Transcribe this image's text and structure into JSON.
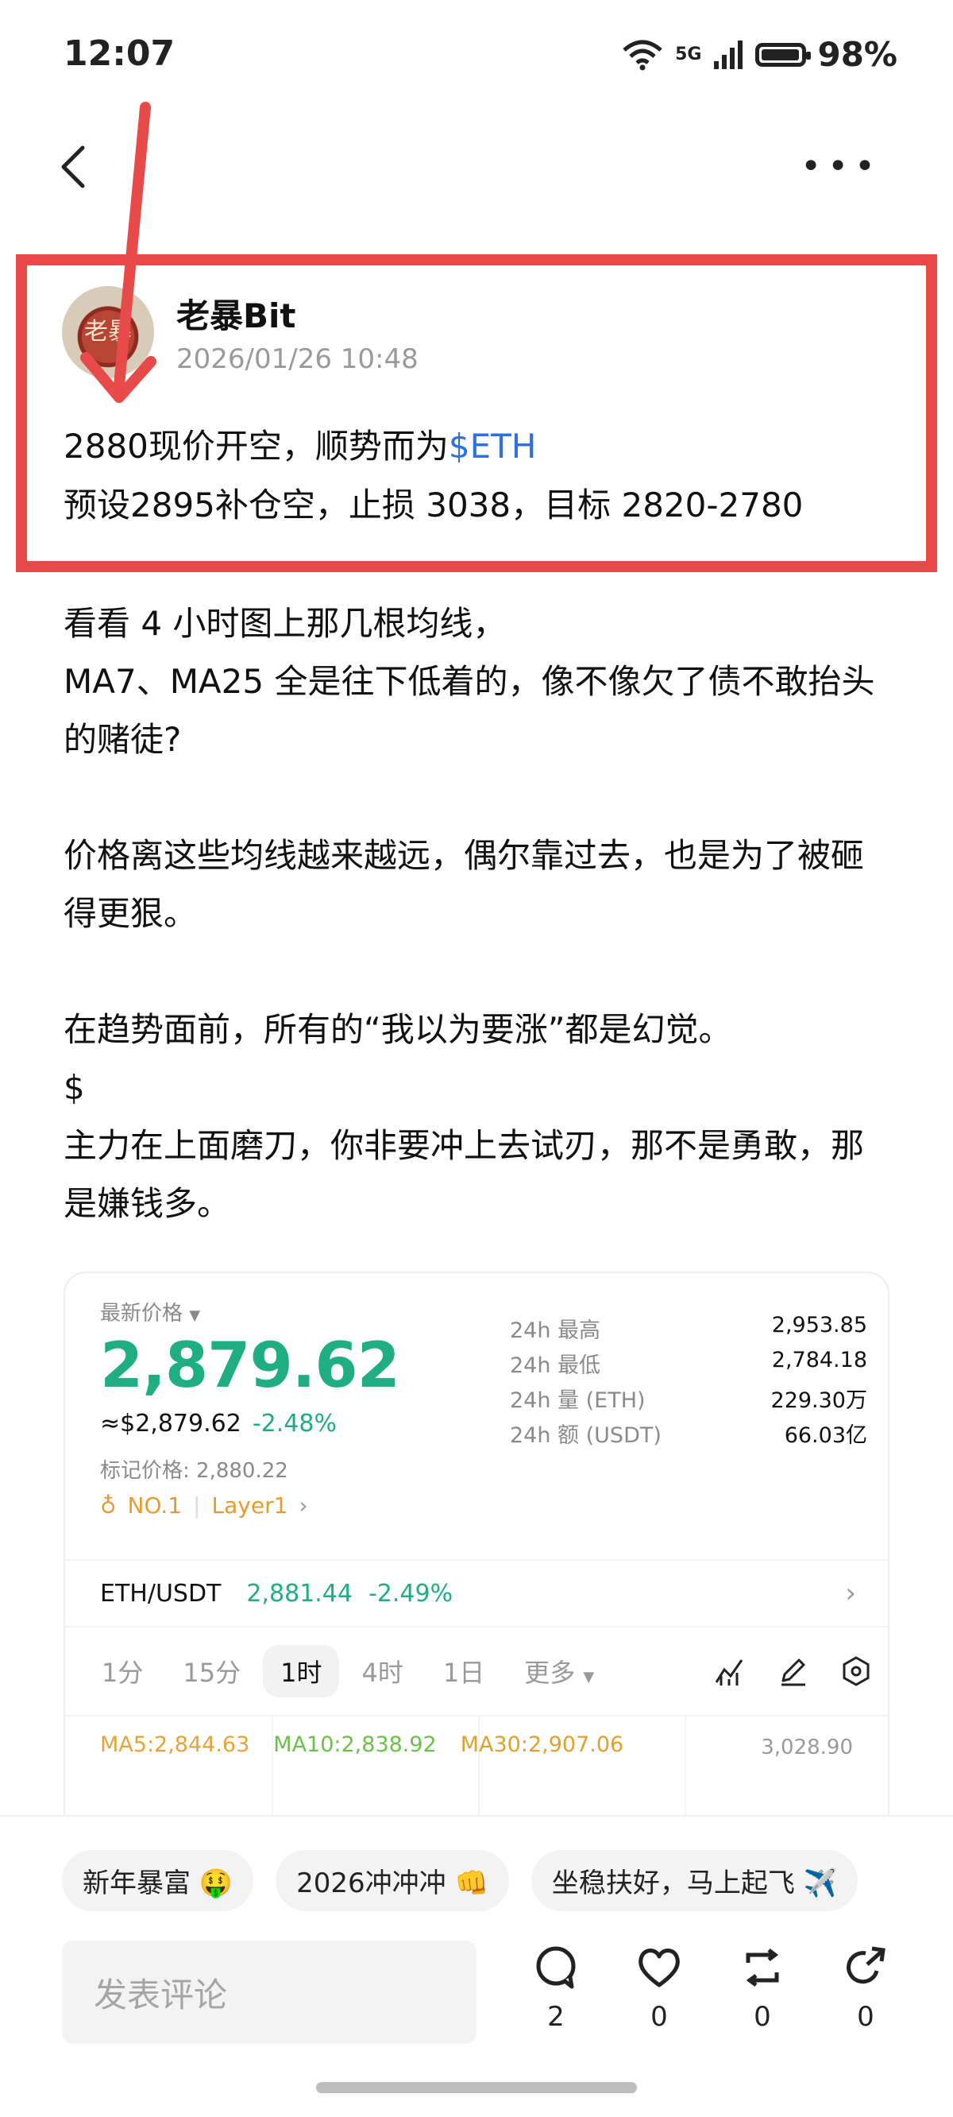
{
  "status_bar": {
    "time": "12:07",
    "network": "5G",
    "battery": "98%",
    "battery_level": 0.98
  },
  "post": {
    "author": "老暴Bit",
    "avatar_text": "老暴",
    "date": "2026/01/26 10:48",
    "line1_text": "2880现价开空，顺势而为",
    "line1_link": "$ETH",
    "line2": "预设2895补仓空，止损 3038，目标 2820-2780",
    "body": [
      "看看 4 小时图上那几根均线，",
      "MA7、MA25 全是往下低着的，像不像欠了债不敢抬头的赌徒?",
      "",
      "价格离这些均线越来越远，偶尔靠过去，也是为了被砸得更狠。",
      "",
      "在趋势面前，所有的“我以为要涨”都是幻觉。",
      "$",
      "主力在上面磨刀，你非要冲上去试刃，那不是勇敢，那是嫌钱多。"
    ]
  },
  "market": {
    "latest_price_label": "最新价格",
    "price": "2,879.62",
    "approx_price": "≈$2,879.62",
    "change": "-2.48%",
    "mark_price": "标记价格: 2,880.22",
    "rank": "NO.1",
    "category": "Layer1",
    "stats": [
      {
        "label": "24h  最高",
        "value": "2,953.85"
      },
      {
        "label": "24h  最低",
        "value": "2,784.18"
      },
      {
        "label": "24h  量 (ETH)",
        "value": "229.30万"
      },
      {
        "label": "24h  额 (USDT)",
        "value": "66.03亿"
      }
    ],
    "pair": "ETH/USDT",
    "pair_price": "2,881.44",
    "pair_change": "-2.49%",
    "timeframes": [
      "1分",
      "15分",
      "1时",
      "4时",
      "1日",
      "更多"
    ],
    "active_timeframe": "1时",
    "ma5": "MA5:2,844.63",
    "ma10": "MA10:2,838.92",
    "ma30": "MA30:2,907.06",
    "y_tick": "3,028.90"
  },
  "tags": [
    "新年暴富 🤑",
    "2026冲冲冲 👊",
    "坐稳扶好，马上起飞 ✈️"
  ],
  "comment_placeholder": "发表评论",
  "actions": [
    {
      "name": "comment",
      "count": "2"
    },
    {
      "name": "like",
      "count": "0"
    },
    {
      "name": "repost",
      "count": "0"
    },
    {
      "name": "share",
      "count": "0"
    }
  ],
  "colors": {
    "highlight": "#e84a4a",
    "positive_green": "#1fae82",
    "link_blue": "#2f6fe4"
  }
}
